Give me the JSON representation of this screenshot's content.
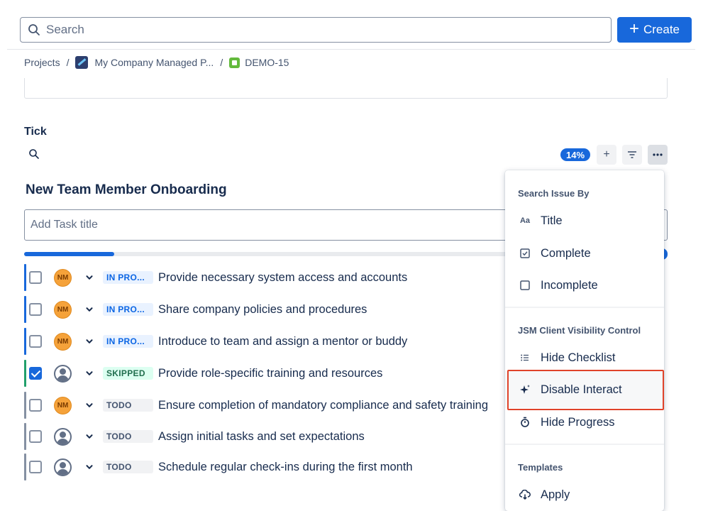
{
  "header": {
    "search_placeholder": "Search",
    "create_label": "Create"
  },
  "breadcrumb": {
    "projects": "Projects",
    "project": "My Company Managed P...",
    "issue": "DEMO-15",
    "sep": "/"
  },
  "section": {
    "title": "Tick"
  },
  "toolbar": {
    "progress_badge": "14%"
  },
  "checklist": {
    "title": "New Team Member Onboarding",
    "add_placeholder": "Add Task title",
    "progress_fraction": 0.14,
    "items": [
      {
        "status": "IN PRO...",
        "text": "Provide necessary system access and accounts",
        "avatar": "NM",
        "checked": false
      },
      {
        "status": "IN PRO...",
        "text": "Share company policies and procedures",
        "avatar": "NM",
        "checked": false
      },
      {
        "status": "IN PRO...",
        "text": "Introduce to team and assign a mentor or buddy",
        "avatar": "NM",
        "checked": false
      },
      {
        "status": "SKIPPED",
        "text": "Provide role-specific training and resources",
        "avatar": "",
        "checked": true
      },
      {
        "status": "TODO",
        "text": "Ensure completion of mandatory compliance and safety training",
        "avatar": "NM",
        "checked": false
      },
      {
        "status": "TODO",
        "text": "Assign initial tasks and set expectations",
        "avatar": "",
        "checked": false
      },
      {
        "status": "TODO",
        "text": "Schedule regular check-ins during the first month",
        "avatar": "",
        "checked": false
      }
    ]
  },
  "menu": {
    "group1_title": "Search Issue By",
    "title_label": "Title",
    "title_icon": "Aa",
    "complete_label": "Complete",
    "incomplete_label": "Incomplete",
    "group2_title": "JSM Client Visibility Control",
    "hide_checklist_label": "Hide Checklist",
    "disable_interact_label": "Disable Interact",
    "hide_progress_label": "Hide Progress",
    "group3_title": "Templates",
    "apply_label": "Apply"
  },
  "colors": {
    "accent": "#1868db",
    "highlight": "#e0432a"
  }
}
